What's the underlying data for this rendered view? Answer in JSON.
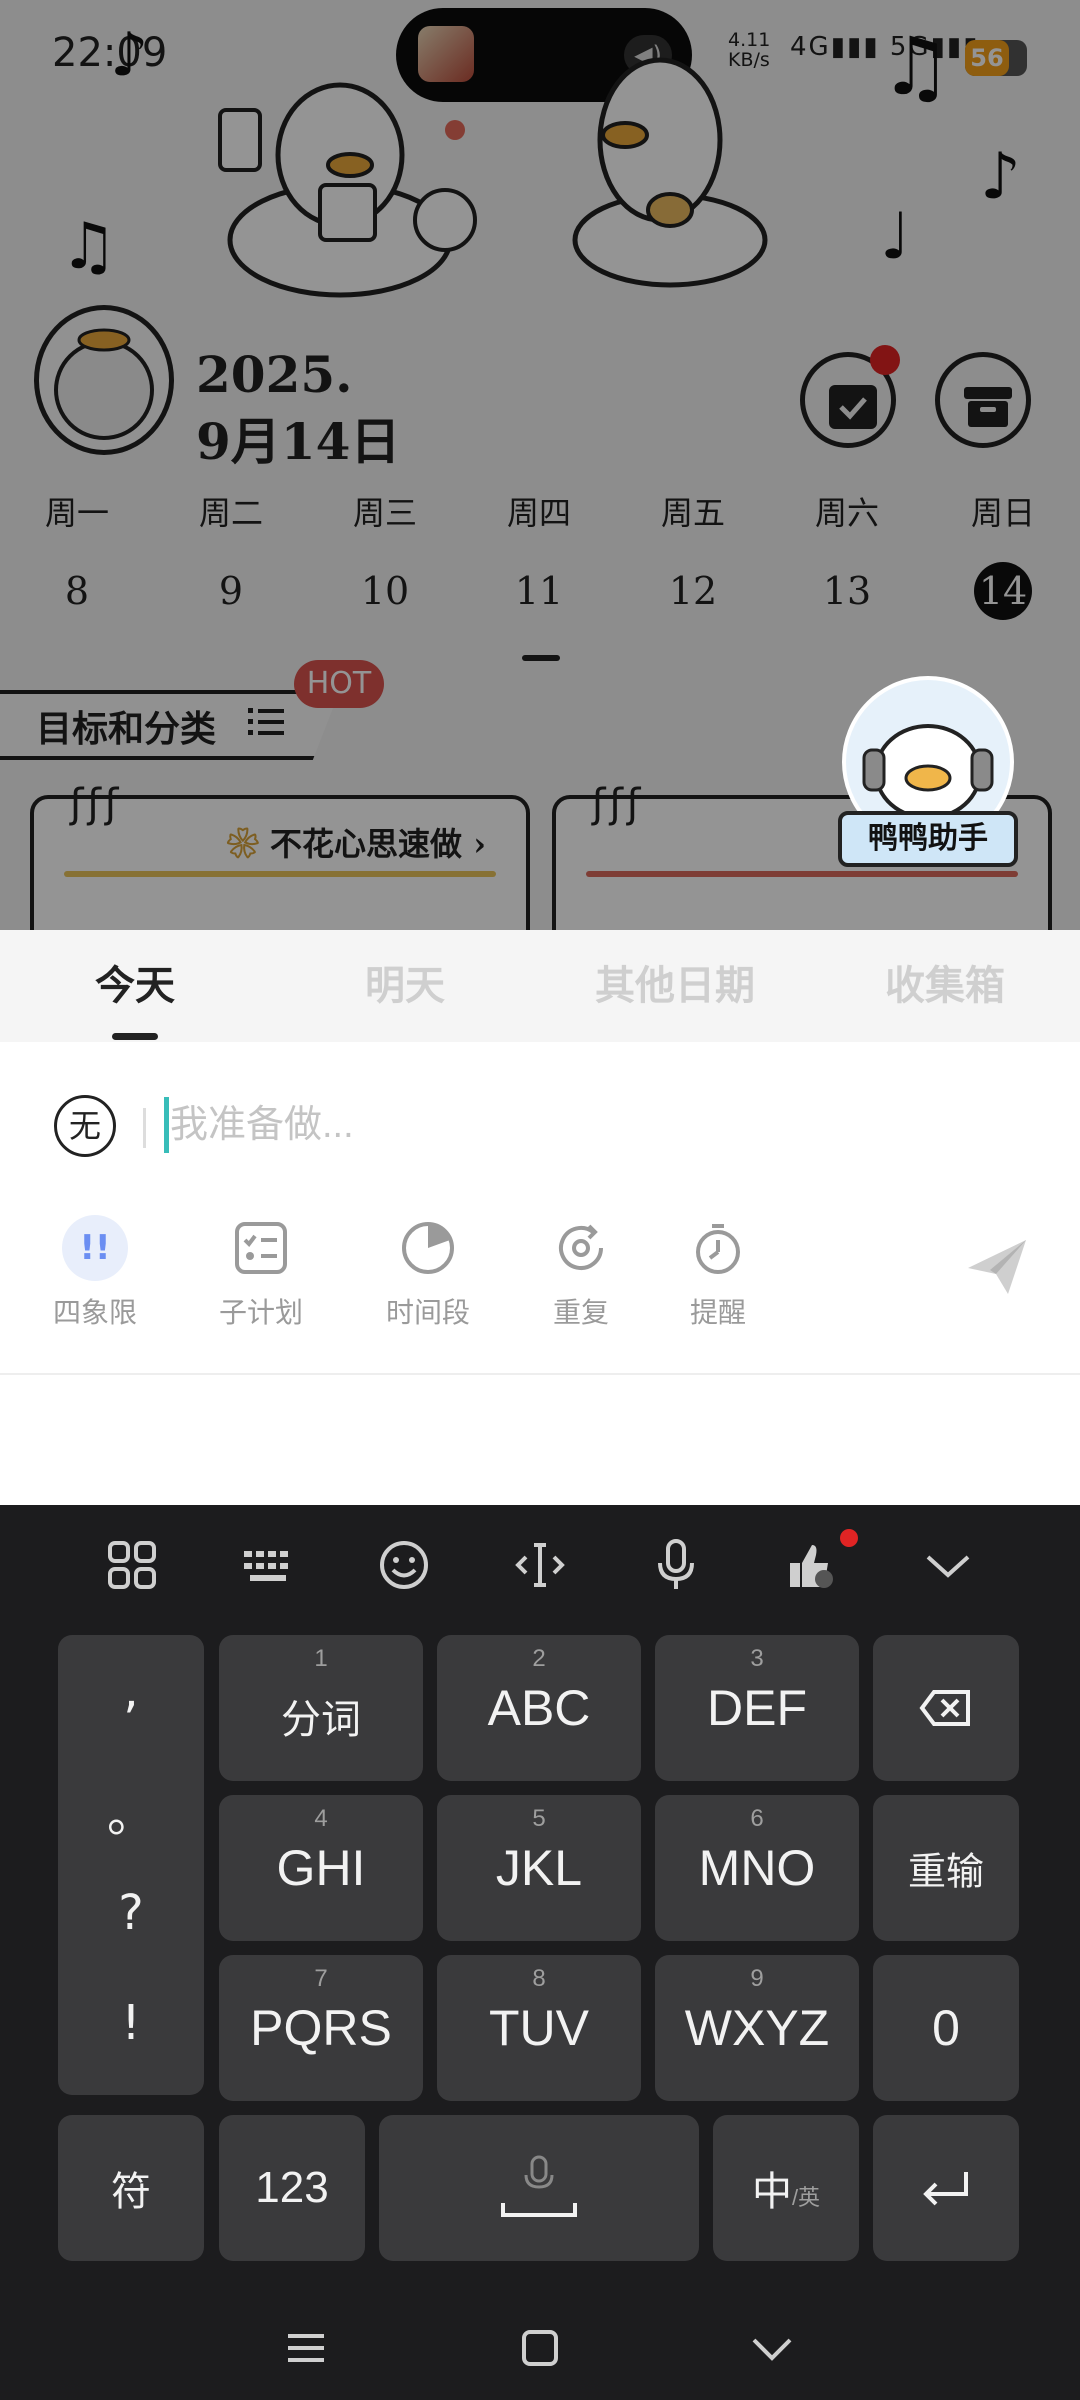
{
  "status_bar": {
    "time": "22:09",
    "net_speed": "4.11",
    "net_unit": "KB/s",
    "net_type1": "4G",
    "net_type2": "5G",
    "battery": "56"
  },
  "header": {
    "date_line1": "2025.",
    "date_line2": "9月14日"
  },
  "week": [
    {
      "name": "周一",
      "num": "8"
    },
    {
      "name": "周二",
      "num": "9"
    },
    {
      "name": "周三",
      "num": "10"
    },
    {
      "name": "周四",
      "num": "11"
    },
    {
      "name": "周五",
      "num": "12"
    },
    {
      "name": "周六",
      "num": "13"
    },
    {
      "name": "周日",
      "num": "14"
    }
  ],
  "goals": {
    "title": "目标和分类",
    "hot": "HOT",
    "card1_title": "不花心思速做"
  },
  "assistant": {
    "label": "鸭鸭助手"
  },
  "tabs": [
    "今天",
    "明天",
    "其他日期",
    "收集箱"
  ],
  "input": {
    "priority_label": "无",
    "placeholder": "我准备做..."
  },
  "tools": [
    {
      "label": "四象限",
      "icon": "exclamation-icon"
    },
    {
      "label": "子计划",
      "icon": "checklist-icon"
    },
    {
      "label": "时间段",
      "icon": "clock-pie-icon"
    },
    {
      "label": "重复",
      "icon": "repeat-icon"
    },
    {
      "label": "提醒",
      "icon": "stopwatch-icon"
    }
  ],
  "keyboard": {
    "keys_row1": [
      {
        "num": "1",
        "main": "分词"
      },
      {
        "num": "2",
        "main": "ABC"
      },
      {
        "num": "3",
        "main": "DEF"
      }
    ],
    "keys_row2": [
      {
        "num": "4",
        "main": "GHI"
      },
      {
        "num": "5",
        "main": "JKL"
      },
      {
        "num": "6",
        "main": "MNO"
      }
    ],
    "keys_row3": [
      {
        "num": "7",
        "main": "PQRS"
      },
      {
        "num": "8",
        "main": "TUV"
      },
      {
        "num": "9",
        "main": "WXYZ"
      }
    ],
    "reenter": "重输",
    "zero": "0",
    "punct": [
      ",",
      "。",
      "?",
      "!"
    ],
    "symbol": "符",
    "numbers": "123",
    "lang_main": "中",
    "lang_sub": "/英"
  },
  "colors": {
    "accent_teal": "#38bdb9",
    "badge_red": "#e02424",
    "battery": "#f5a01a",
    "keyboard_bg": "#1c1c1e",
    "key_bg": "#3a3a3c"
  }
}
